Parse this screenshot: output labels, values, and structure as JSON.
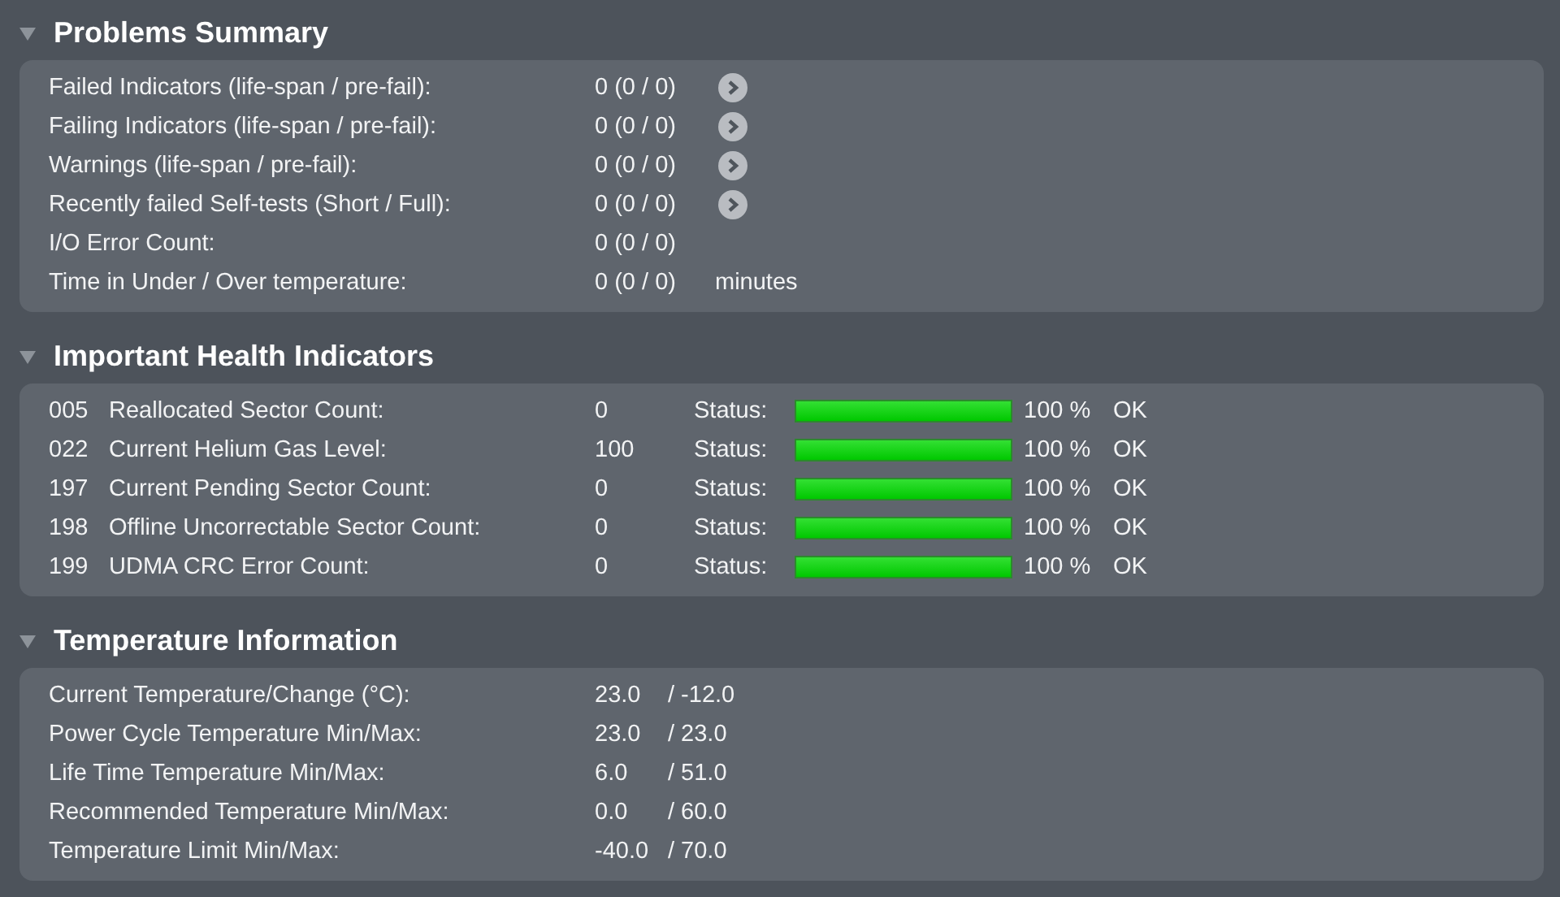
{
  "problems_summary": {
    "title": "Problems Summary",
    "expanded": true,
    "rows": [
      {
        "label": "Failed Indicators (life-span / pre-fail):",
        "value": "0 (0 / 0)",
        "details_button": true
      },
      {
        "label": "Failing Indicators (life-span / pre-fail):",
        "value": "0 (0 / 0)",
        "details_button": true
      },
      {
        "label": "Warnings (life-span / pre-fail):",
        "value": "0 (0 / 0)",
        "details_button": true
      },
      {
        "label": "Recently failed Self-tests (Short / Full):",
        "value": "0 (0 / 0)",
        "details_button": true
      },
      {
        "label": "I/O Error Count:",
        "value": "0 (0 / 0)",
        "details_button": false
      },
      {
        "label": "Time in Under / Over temperature:",
        "value": "0 (0 / 0)",
        "details_button": false,
        "unit": "minutes"
      }
    ]
  },
  "health_indicators": {
    "title": "Important Health Indicators",
    "expanded": true,
    "rows": [
      {
        "id": "005",
        "name": "Reallocated Sector Count:",
        "value": "0",
        "status_label": "Status:",
        "level": 1,
        "percent": "100 %",
        "status": "OK"
      },
      {
        "id": "022",
        "name": "Current Helium Gas Level:",
        "value": "100",
        "status_label": "Status:",
        "level": 1,
        "percent": "100 %",
        "status": "OK"
      },
      {
        "id": "197",
        "name": "Current Pending Sector Count:",
        "value": "0",
        "status_label": "Status:",
        "level": 1,
        "percent": "100 %",
        "status": "OK"
      },
      {
        "id": "198",
        "name": "Offline Uncorrectable Sector Count:",
        "value": "0",
        "status_label": "Status:",
        "level": 1,
        "percent": "100 %",
        "status": "OK"
      },
      {
        "id": "199",
        "name": "UDMA CRC Error Count:",
        "value": "0",
        "status_label": "Status:",
        "level": 1,
        "percent": "100 %",
        "status": "OK"
      }
    ]
  },
  "temperature_information": {
    "title": "Temperature Information",
    "expanded": true,
    "rows": [
      {
        "label": "Current Temperature/Change (°C):",
        "first": "23.0",
        "second": "/ -12.0"
      },
      {
        "label": "Power Cycle Temperature Min/Max:",
        "first": "23.0",
        "second": "/ 23.0"
      },
      {
        "label": "Life Time Temperature Min/Max:",
        "first": "6.0",
        "second": "/ 51.0"
      },
      {
        "label": "Recommended Temperature Min/Max:",
        "first": "0.0",
        "second": "/ 60.0"
      },
      {
        "label": "Temperature Limit Min/Max:",
        "first": "-40.0",
        "second": "/ 70.0"
      }
    ]
  }
}
